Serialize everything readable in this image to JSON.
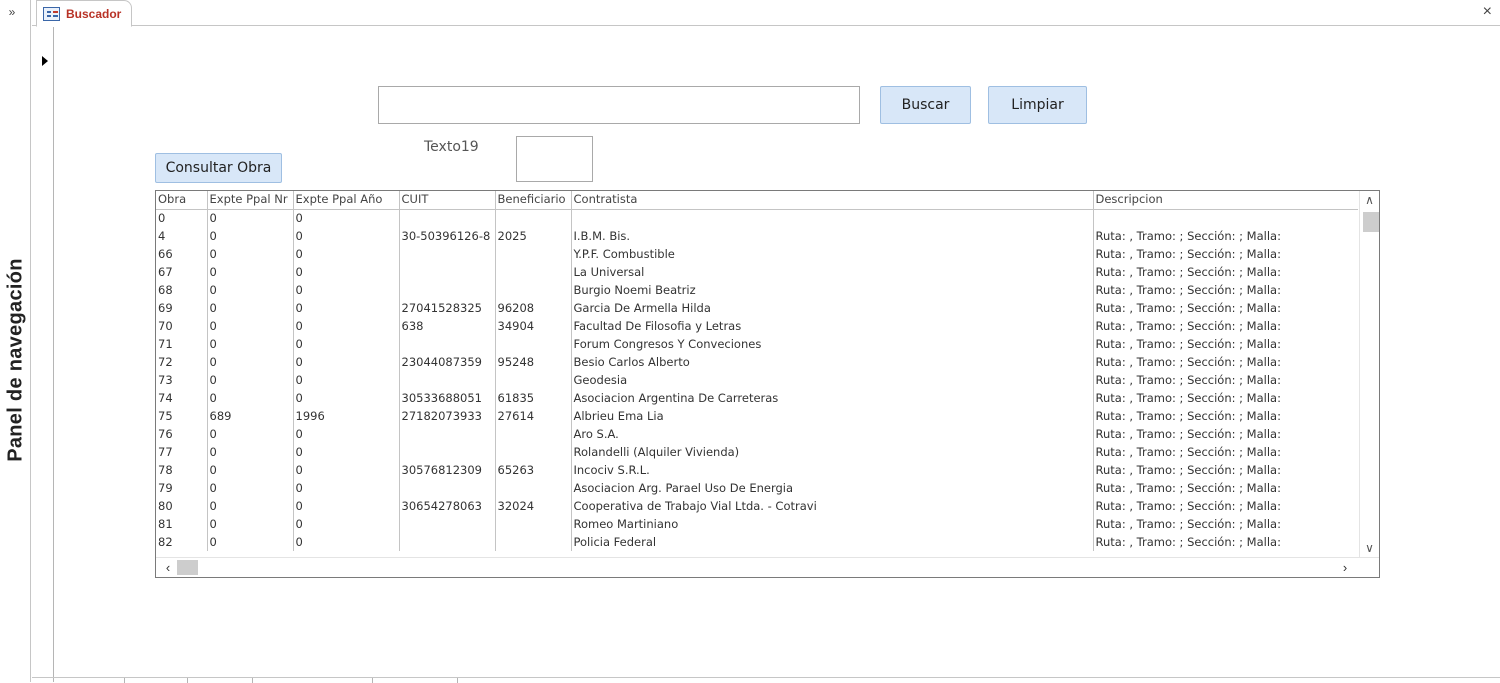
{
  "nav_pane": {
    "toggle": "»",
    "label": "Panel de navegación"
  },
  "tab": {
    "label": "Buscador",
    "close": "×"
  },
  "form": {
    "search_value": "",
    "buscar_label": "Buscar",
    "limpiar_label": "Limpiar",
    "consultar_label": "Consultar Obra",
    "texto19_label": "Texto19"
  },
  "colors": {
    "tab_label": "#b83226",
    "button_bg": "#d8e7f8",
    "button_border": "#9fbfe2"
  },
  "list": {
    "columns": [
      "Obra",
      "Expte Ppal Nr",
      "Expte Ppal Año",
      "CUIT",
      "Beneficiario",
      "Contratista",
      "Descripcion"
    ],
    "rows": [
      [
        "0",
        "0",
        "0",
        "",
        "",
        "",
        ""
      ],
      [
        "4",
        "0",
        "0",
        "30-50396126-8",
        "2025",
        "I.B.M. Bis.",
        "Ruta: , Tramo: ; Sección: ; Malla:"
      ],
      [
        "66",
        "0",
        "0",
        "",
        "",
        "Y.P.F. Combustible",
        "Ruta: , Tramo: ; Sección: ; Malla:"
      ],
      [
        "67",
        "0",
        "0",
        "",
        "",
        "La Universal",
        "Ruta: , Tramo: ; Sección: ; Malla:"
      ],
      [
        "68",
        "0",
        "0",
        "",
        "",
        "Burgio Noemi Beatriz",
        "Ruta: , Tramo: ; Sección: ; Malla:"
      ],
      [
        "69",
        "0",
        "0",
        "27041528325",
        "96208",
        "Garcia De Armella Hilda",
        "Ruta: , Tramo: ; Sección: ; Malla:"
      ],
      [
        "70",
        "0",
        "0",
        "638",
        "34904",
        "Facultad De Filosofia y Letras",
        "Ruta: , Tramo: ; Sección: ; Malla:"
      ],
      [
        "71",
        "0",
        "0",
        "",
        "",
        "Forum Congresos Y Conveciones",
        "Ruta: , Tramo: ; Sección: ; Malla:"
      ],
      [
        "72",
        "0",
        "0",
        "23044087359",
        "95248",
        "Besio Carlos Alberto",
        "Ruta: , Tramo: ; Sección: ; Malla:"
      ],
      [
        "73",
        "0",
        "0",
        "",
        "",
        "Geodesia",
        "Ruta: , Tramo: ; Sección: ; Malla:"
      ],
      [
        "74",
        "0",
        "0",
        "30533688051",
        "61835",
        "Asociacion Argentina De Carreteras",
        "Ruta: , Tramo: ; Sección: ; Malla:"
      ],
      [
        "75",
        "689",
        "1996",
        "27182073933",
        "27614",
        "Albrieu Ema Lia",
        "Ruta: , Tramo: ; Sección: ; Malla:"
      ],
      [
        "76",
        "0",
        "0",
        "",
        "",
        "Aro S.A.",
        "Ruta: , Tramo: ; Sección: ; Malla:"
      ],
      [
        "77",
        "0",
        "0",
        "",
        "",
        "Rolandelli (Alquiler Vivienda)",
        "Ruta: , Tramo: ; Sección: ; Malla:"
      ],
      [
        "78",
        "0",
        "0",
        "30576812309",
        "65263",
        "Incociv S.R.L.",
        "Ruta: , Tramo: ; Sección: ; Malla:"
      ],
      [
        "79",
        "0",
        "0",
        "",
        "",
        "Asociacion Arg. Parael Uso De Energia",
        "Ruta: , Tramo: ; Sección: ; Malla:"
      ],
      [
        "80",
        "0",
        "0",
        "30654278063",
        "32024",
        "Cooperativa de Trabajo Vial Ltda. - Cotravi",
        "Ruta: , Tramo: ; Sección: ; Malla:"
      ],
      [
        "81",
        "0",
        "0",
        "",
        "",
        "Romeo Martiniano",
        "Ruta: , Tramo: ; Sección: ; Malla:"
      ],
      [
        "82",
        "0",
        "0",
        "",
        "",
        "Policia Federal",
        "Ruta: , Tramo: ; Sección: ; Malla:"
      ]
    ]
  }
}
